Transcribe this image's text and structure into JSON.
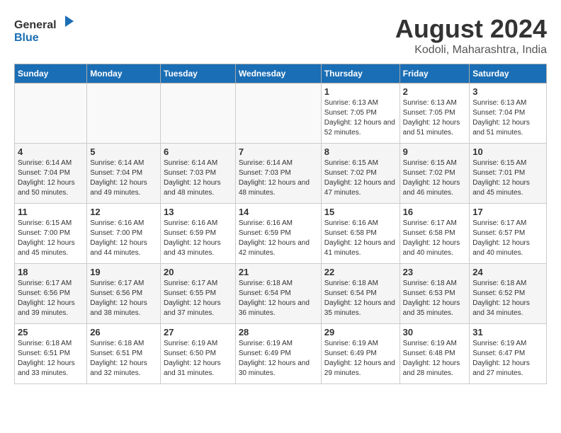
{
  "header": {
    "logo_line1": "General",
    "logo_line2": "Blue",
    "main_title": "August 2024",
    "subtitle": "Kodoli, Maharashtra, India"
  },
  "calendar": {
    "days_of_week": [
      "Sunday",
      "Monday",
      "Tuesday",
      "Wednesday",
      "Thursday",
      "Friday",
      "Saturday"
    ],
    "weeks": [
      [
        {
          "day": "",
          "info": ""
        },
        {
          "day": "",
          "info": ""
        },
        {
          "day": "",
          "info": ""
        },
        {
          "day": "",
          "info": ""
        },
        {
          "day": "1",
          "info": "Sunrise: 6:13 AM\nSunset: 7:05 PM\nDaylight: 12 hours\nand 52 minutes."
        },
        {
          "day": "2",
          "info": "Sunrise: 6:13 AM\nSunset: 7:05 PM\nDaylight: 12 hours\nand 51 minutes."
        },
        {
          "day": "3",
          "info": "Sunrise: 6:13 AM\nSunset: 7:04 PM\nDaylight: 12 hours\nand 51 minutes."
        }
      ],
      [
        {
          "day": "4",
          "info": "Sunrise: 6:14 AM\nSunset: 7:04 PM\nDaylight: 12 hours\nand 50 minutes."
        },
        {
          "day": "5",
          "info": "Sunrise: 6:14 AM\nSunset: 7:04 PM\nDaylight: 12 hours\nand 49 minutes."
        },
        {
          "day": "6",
          "info": "Sunrise: 6:14 AM\nSunset: 7:03 PM\nDaylight: 12 hours\nand 48 minutes."
        },
        {
          "day": "7",
          "info": "Sunrise: 6:14 AM\nSunset: 7:03 PM\nDaylight: 12 hours\nand 48 minutes."
        },
        {
          "day": "8",
          "info": "Sunrise: 6:15 AM\nSunset: 7:02 PM\nDaylight: 12 hours\nand 47 minutes."
        },
        {
          "day": "9",
          "info": "Sunrise: 6:15 AM\nSunset: 7:02 PM\nDaylight: 12 hours\nand 46 minutes."
        },
        {
          "day": "10",
          "info": "Sunrise: 6:15 AM\nSunset: 7:01 PM\nDaylight: 12 hours\nand 45 minutes."
        }
      ],
      [
        {
          "day": "11",
          "info": "Sunrise: 6:15 AM\nSunset: 7:00 PM\nDaylight: 12 hours\nand 45 minutes."
        },
        {
          "day": "12",
          "info": "Sunrise: 6:16 AM\nSunset: 7:00 PM\nDaylight: 12 hours\nand 44 minutes."
        },
        {
          "day": "13",
          "info": "Sunrise: 6:16 AM\nSunset: 6:59 PM\nDaylight: 12 hours\nand 43 minutes."
        },
        {
          "day": "14",
          "info": "Sunrise: 6:16 AM\nSunset: 6:59 PM\nDaylight: 12 hours\nand 42 minutes."
        },
        {
          "day": "15",
          "info": "Sunrise: 6:16 AM\nSunset: 6:58 PM\nDaylight: 12 hours\nand 41 minutes."
        },
        {
          "day": "16",
          "info": "Sunrise: 6:17 AM\nSunset: 6:58 PM\nDaylight: 12 hours\nand 40 minutes."
        },
        {
          "day": "17",
          "info": "Sunrise: 6:17 AM\nSunset: 6:57 PM\nDaylight: 12 hours\nand 40 minutes."
        }
      ],
      [
        {
          "day": "18",
          "info": "Sunrise: 6:17 AM\nSunset: 6:56 PM\nDaylight: 12 hours\nand 39 minutes."
        },
        {
          "day": "19",
          "info": "Sunrise: 6:17 AM\nSunset: 6:56 PM\nDaylight: 12 hours\nand 38 minutes."
        },
        {
          "day": "20",
          "info": "Sunrise: 6:17 AM\nSunset: 6:55 PM\nDaylight: 12 hours\nand 37 minutes."
        },
        {
          "day": "21",
          "info": "Sunrise: 6:18 AM\nSunset: 6:54 PM\nDaylight: 12 hours\nand 36 minutes."
        },
        {
          "day": "22",
          "info": "Sunrise: 6:18 AM\nSunset: 6:54 PM\nDaylight: 12 hours\nand 35 minutes."
        },
        {
          "day": "23",
          "info": "Sunrise: 6:18 AM\nSunset: 6:53 PM\nDaylight: 12 hours\nand 35 minutes."
        },
        {
          "day": "24",
          "info": "Sunrise: 6:18 AM\nSunset: 6:52 PM\nDaylight: 12 hours\nand 34 minutes."
        }
      ],
      [
        {
          "day": "25",
          "info": "Sunrise: 6:18 AM\nSunset: 6:51 PM\nDaylight: 12 hours\nand 33 minutes."
        },
        {
          "day": "26",
          "info": "Sunrise: 6:18 AM\nSunset: 6:51 PM\nDaylight: 12 hours\nand 32 minutes."
        },
        {
          "day": "27",
          "info": "Sunrise: 6:19 AM\nSunset: 6:50 PM\nDaylight: 12 hours\nand 31 minutes."
        },
        {
          "day": "28",
          "info": "Sunrise: 6:19 AM\nSunset: 6:49 PM\nDaylight: 12 hours\nand 30 minutes."
        },
        {
          "day": "29",
          "info": "Sunrise: 6:19 AM\nSunset: 6:49 PM\nDaylight: 12 hours\nand 29 minutes."
        },
        {
          "day": "30",
          "info": "Sunrise: 6:19 AM\nSunset: 6:48 PM\nDaylight: 12 hours\nand 28 minutes."
        },
        {
          "day": "31",
          "info": "Sunrise: 6:19 AM\nSunset: 6:47 PM\nDaylight: 12 hours\nand 27 minutes."
        }
      ]
    ]
  }
}
